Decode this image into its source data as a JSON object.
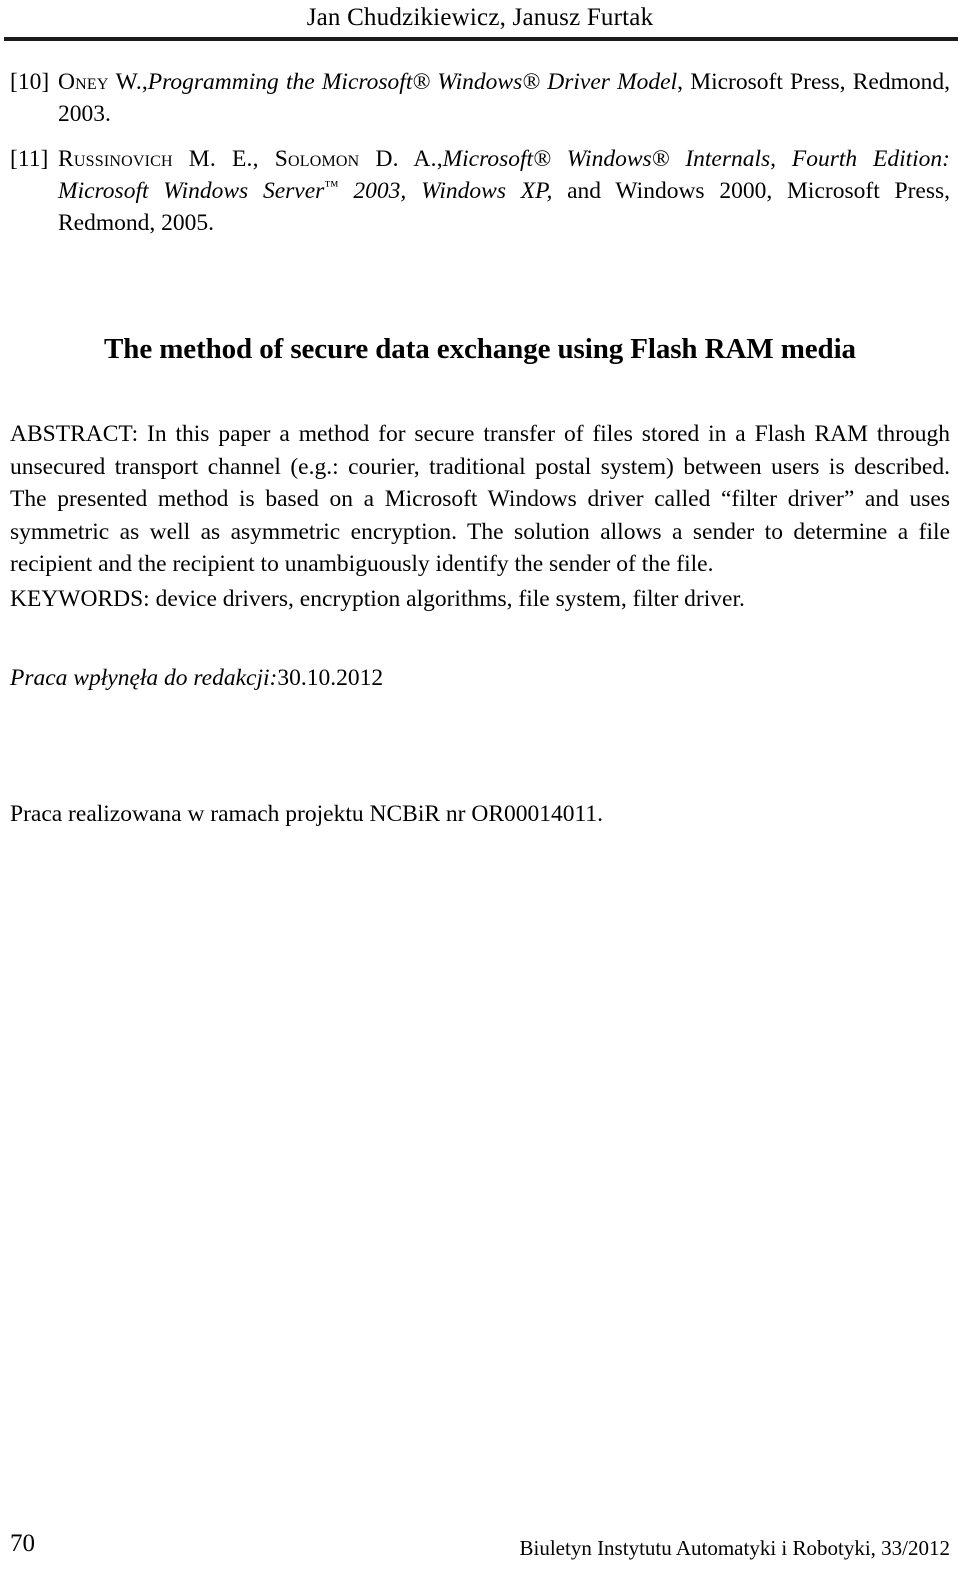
{
  "running_head": "Jan Chudzikiewicz, Janusz Furtak",
  "references": [
    {
      "marker": "[10]",
      "author": "Oney W.",
      "author_sep": ",",
      "title": "Programming the Microsoft® Windows® Driver Model",
      "tail": ", Microsoft Press, Redmond, 2003."
    },
    {
      "marker": "[11]",
      "author": "Russinovich M. E., Solomon D. A.",
      "author_sep": ",",
      "title_part1": "Microsoft® Windows® Internals, Fourth Edition: Microsoft Windows Server",
      "title_tm": "™",
      "title_part2": " 2003, Windows XP,",
      "tail": " and Windows 2000, Microsoft Press, Redmond, 2005."
    }
  ],
  "article": {
    "title": "The method of secure data exchange using Flash RAM media",
    "abstract_label": "ABSTRACT:",
    "abstract_text": " In this paper a method for secure transfer of files stored in a Flash RAM through unsecured transport channel (e.g.: courier, traditional postal system) between users is described. The presented method is based on a Microsoft Windows driver called “filter driver” and uses symmetric as well as asymmetric encryption. The solution allows a sender to determine a file recipient and the recipient to unambiguously identify  the sender of the file.",
    "keywords_label": "KEYWORDS:",
    "keywords_text": " device drivers, encryption algorithms, file system, filter driver."
  },
  "received": {
    "label": "Praca wpłynęła do redakcji:",
    "date": "30.10.2012"
  },
  "funding_note": "Praca realizowana w ramach projektu NCBiR nr OR00014011.",
  "footer": {
    "page_number": "70",
    "journal": "Biuletyn Instytutu Automatyki i Robotyki, 33/2012"
  }
}
